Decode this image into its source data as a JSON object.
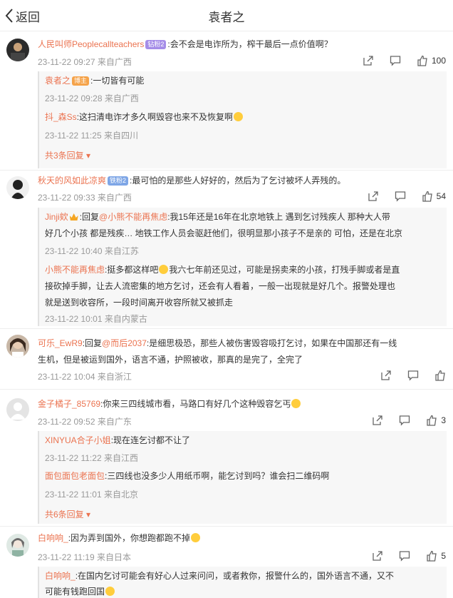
{
  "header": {
    "back_label": "返回",
    "title": "袁者之"
  },
  "comments": [
    {
      "user": "人民叫师Peoplecallteachers",
      "badge": "钻粉2",
      "text": ":会不会是电诈所为，榨干最后一点价值啊？",
      "time": "23-11-22 09:27 来自广西",
      "likes": "100",
      "replies": [
        {
          "user": "袁者之",
          "badge": "博主",
          "text": ":一切皆有可能",
          "time": "23-11-22 09:28 来自广西"
        },
        {
          "user": "抖_森Ss",
          "text": ":这扫清电诈才多久啊毁容也来不及恢复啊",
          "time": "23-11-22 11:25 来自四川"
        }
      ],
      "more": "共3条回复"
    },
    {
      "user": "秋天的风如此凉爽",
      "badge": "铁粉2",
      "text": ":最可怕的是那些人好好的，然后为了乞讨被坏人弄残的。",
      "time": "23-11-22 09:33 来自广西",
      "likes": "54",
      "replies": [
        {
          "user": "Jinji欸",
          "prefix": ":回复",
          "mention": "@小熊不能再焦虑",
          "text_line1": ":我15年还是16年在北京地铁上 遇到乞讨残疾人 那种大人带",
          "text_line2": "好几个小孩 都是残疾… 地铁工作人员会驱赶他们，很明显那小孩子不是亲的 可怕，还是在北京",
          "time": "23-11-22 10:40 来自江苏"
        },
        {
          "user": "小熊不能再焦虑",
          "text_line1": ":挺多都这样吧",
          "text_line1b": "我六七年前还见过，可能是拐卖来的小孩，打残手脚或者是直",
          "text_line2": "接砍掉手脚，让去人流密集的地方乞讨，还会有人看着，一般一出现就是好几个。报警处理也",
          "text_line3": "就是送到收容所，一段时间离开收容所就又被抓走",
          "time": "23-11-22 10:01 来自内蒙古"
        }
      ]
    },
    {
      "user": "可乐_EwR9",
      "prefix": ":回复",
      "mention": "@而后2037",
      "text_line1": ":是细思极恐，那些人被伤害毁容吸打乞讨，如果在中国那还有一线",
      "text_line2": "生机，但是被运到国外，语言不通，护照被收，那真的是完了，全完了",
      "time": "23-11-22 10:04 来自浙江"
    },
    {
      "user": "金子橘子_85769",
      "text": ":你来三四线城市看，马路口有好几个这种毁容乞丐",
      "time": "23-11-22 09:52 来自广东",
      "likes": "3",
      "replies": [
        {
          "user": "XINYUA合子小姐",
          "text": ":现在连乞讨都不让了",
          "time": "23-11-22 11:22 来自江西"
        },
        {
          "user": "面包面包老面包",
          "text": ":三四线也没多少人用纸币啊，能乞讨到吗？谁会扫二维码啊",
          "time": "23-11-22 11:01 来自北京"
        }
      ],
      "more": "共6条回复"
    },
    {
      "user": "白响响_",
      "text": ":因为弄到国外，你想跑都跑不掉",
      "time": "23-11-22 11:19 来自日本",
      "likes": "5",
      "replies": [
        {
          "user": "白响响_",
          "text_line1": ":在国内乞讨可能会有好心人过来问问，或者救你，报警什么的，国外语言不通，又不",
          "text_line2": "可能有钱跑回国"
        }
      ]
    }
  ]
}
